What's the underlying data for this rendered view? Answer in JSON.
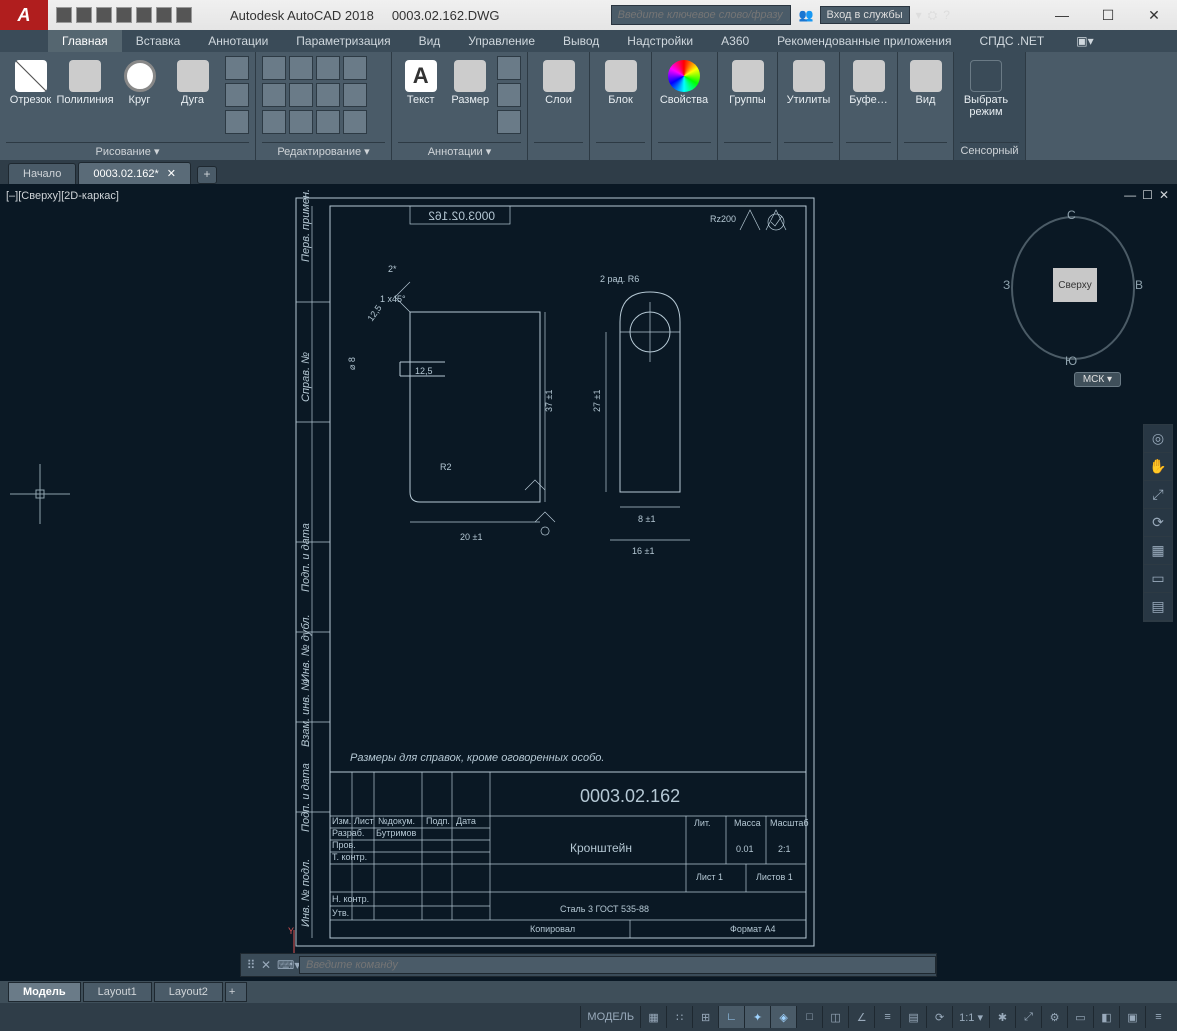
{
  "title": {
    "vendor": "Autodesk AutoCAD 2018",
    "file": "0003.02.162.DWG"
  },
  "search": {
    "placeholder": "Введите ключевое слово/фразу"
  },
  "signin": "Вход в службы",
  "menu": {
    "items": [
      "Главная",
      "Вставка",
      "Аннотации",
      "Параметризация",
      "Вид",
      "Управление",
      "Вывод",
      "Надстройки",
      "A360",
      "Рекомендованные приложения",
      "СПДС .NET"
    ],
    "active": 0
  },
  "ribbon": {
    "draw": {
      "title": "Рисование ▾",
      "btns": [
        "Отрезок",
        "Полилиния",
        "Круг",
        "Дуга"
      ]
    },
    "edit": {
      "title": "Редактирование ▾"
    },
    "annot": {
      "title": "Аннотации ▾",
      "btns": [
        "Текст",
        "Размер"
      ]
    },
    "layers": {
      "title": "Слои"
    },
    "block": {
      "title": "Блок"
    },
    "prop": {
      "title": "Свойства"
    },
    "groups": {
      "title": "Группы"
    },
    "util": {
      "title": "Утилиты"
    },
    "clip": {
      "title": "Буфе…"
    },
    "view": {
      "title": "Вид"
    },
    "touch": {
      "title": "Сенсорный",
      "btn": "Выбрать режим"
    }
  },
  "filetabs": {
    "home": "Начало",
    "open": "0003.02.162*",
    "plus": "+"
  },
  "viewport": {
    "label": "[–][Сверху][2D-каркас]"
  },
  "viewcube": {
    "face": "Сверху",
    "n": "С",
    "s": "Ю",
    "e": "В",
    "w": "З",
    "wcs": "МСК ▾"
  },
  "cmd": {
    "placeholder": "Введите команду"
  },
  "bottom": {
    "tabs": [
      "Модель",
      "Layout1",
      "Layout2"
    ],
    "active": 0
  },
  "status": {
    "model": "МОДЕЛЬ",
    "scale": "1:1 ▾"
  },
  "drawing": {
    "partno": "0003.02.162",
    "partno_mirror": "0003.02.162",
    "note": "Размеры для справок, кроме оговоренных особо.",
    "titleblock": {
      "name": "Кронштейн",
      "material": "Сталь 3 ГОСТ 535-88",
      "mass_hdr": "Масса",
      "scale_hdr": "Масштаб",
      "lit_hdr": "Лит.",
      "mass": "0.01",
      "scale": "2:1",
      "row_hdrs": [
        "Изм.",
        "Лист",
        "№докум.",
        "Подп.",
        "Дата"
      ],
      "rows": [
        [
          "Разраб.",
          "Бутримов"
        ],
        [
          "Пров.",
          ""
        ],
        [
          "Т. контр.",
          ""
        ],
        [
          "Н. контр.",
          ""
        ],
        [
          "Утв.",
          ""
        ]
      ],
      "sheet": "Лист 1",
      "sheets": "Листов 1",
      "copy": "Копировал",
      "format": "Формат А4"
    },
    "side_labels": [
      "Перв. примен.",
      "Справ. №",
      "Подп. и дата",
      "Инв. № дубл.",
      "Взам. инв. №",
      "Подп. и дата",
      "Инв. № подл."
    ],
    "dims": {
      "rz": "Rz200",
      "r6": "2 рад. R6",
      "cham": "1 x45°",
      "two": "2*",
      "d8": "⌀ 8",
      "t125": "12,5",
      "ang125": "12,5",
      "r2": "R2",
      "h37": "37 ±1",
      "h27": "27 ±1",
      "w20": "20 ±1",
      "w8": "8 ±1",
      "w16": "16 ±1"
    }
  }
}
